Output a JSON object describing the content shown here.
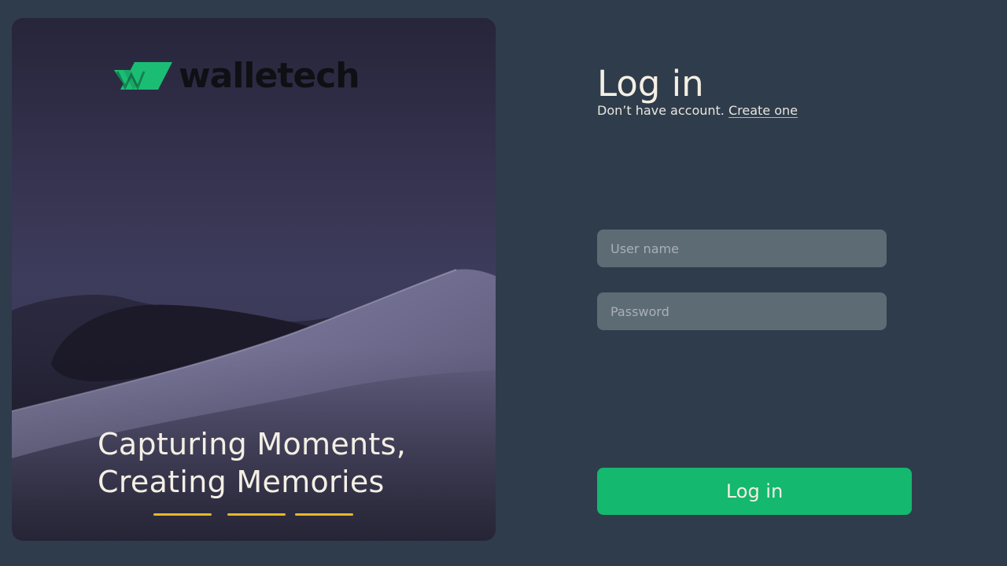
{
  "brand": {
    "name": "walletech",
    "logo_icon": "walletech-logo-mark",
    "logo_color": "#1bbd74",
    "text_color": "#0f0f14"
  },
  "hero": {
    "tagline_line1": "Capturing Moments,",
    "tagline_line2": "Creating Memories",
    "slide_count": 3,
    "indicator_color": "#e6b82a"
  },
  "login": {
    "title": "Log in",
    "signup_prompt": "Don’t have account.",
    "signup_link": "Create one",
    "username_placeholder": "User name",
    "password_placeholder": "Password",
    "submit_label": "Log in"
  },
  "colors": {
    "background": "#2f3c4b",
    "accent": "#14b86e",
    "input_bg": "#5d6b75"
  }
}
